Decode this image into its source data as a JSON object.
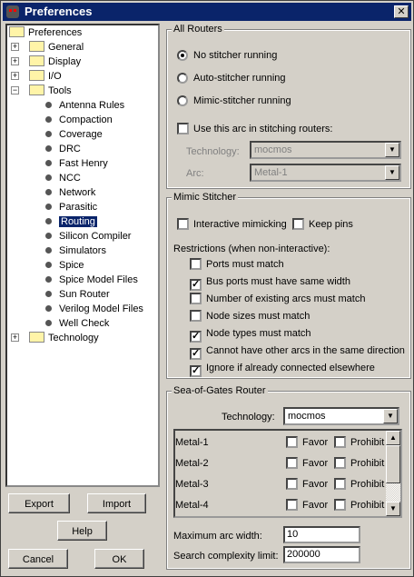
{
  "window": {
    "title": "Preferences",
    "close": "✕"
  },
  "tree": {
    "root": "Preferences",
    "folders": [
      {
        "label": "General",
        "expanded": false
      },
      {
        "label": "Display",
        "expanded": false
      },
      {
        "label": "I/O",
        "expanded": false
      },
      {
        "label": "Tools",
        "expanded": true
      }
    ],
    "tools": [
      "Antenna Rules",
      "Compaction",
      "Coverage",
      "DRC",
      "Fast Henry",
      "NCC",
      "Network",
      "Parasitic",
      "Routing",
      "Silicon Compiler",
      "Simulators",
      "Spice",
      "Spice Model Files",
      "Sun Router",
      "Verilog Model Files",
      "Well Check"
    ],
    "selected": "Routing",
    "last_folder": "Technology"
  },
  "buttons": {
    "export": "Export",
    "import": "Import",
    "help": "Help",
    "cancel": "Cancel",
    "ok": "OK"
  },
  "all_routers": {
    "title": "All Routers",
    "radios": [
      {
        "label": "No stitcher running",
        "checked": true
      },
      {
        "label": "Auto-stitcher running",
        "checked": false
      },
      {
        "label": "Mimic-stitcher running",
        "checked": false
      }
    ],
    "use_arc": {
      "label": "Use this arc in stitching routers:",
      "checked": false
    },
    "technology_label": "Technology:",
    "technology_value": "mocmos",
    "arc_label": "Arc:",
    "arc_value": "Metal-1"
  },
  "mimic": {
    "title": "Mimic Stitcher",
    "interactive": {
      "label": "Interactive mimicking",
      "checked": false
    },
    "keep_pins": {
      "label": "Keep pins",
      "checked": false
    },
    "restrictions_label": "Restrictions (when non-interactive):",
    "restrictions": [
      {
        "label": "Ports must match",
        "checked": false
      },
      {
        "label": "Bus ports must have same width",
        "checked": true
      },
      {
        "label": "Number of existing arcs must match",
        "checked": false
      },
      {
        "label": "Node sizes must match",
        "checked": false
      },
      {
        "label": "Node types must match",
        "checked": true
      },
      {
        "label": "Cannot have other arcs in the same direction",
        "checked": true
      },
      {
        "label": "Ignore if already connected elsewhere",
        "checked": true
      }
    ]
  },
  "sog": {
    "title": "Sea-of-Gates Router",
    "technology_label": "Technology:",
    "technology_value": "mocmos",
    "favor": "Favor",
    "prohibit": "Prohibit",
    "arcs": [
      "Metal-1",
      "Metal-2",
      "Metal-3",
      "Metal-4"
    ],
    "max_width_label": "Maximum arc width:",
    "max_width": "10",
    "complexity_label": "Search complexity limit:",
    "complexity": "200000"
  }
}
